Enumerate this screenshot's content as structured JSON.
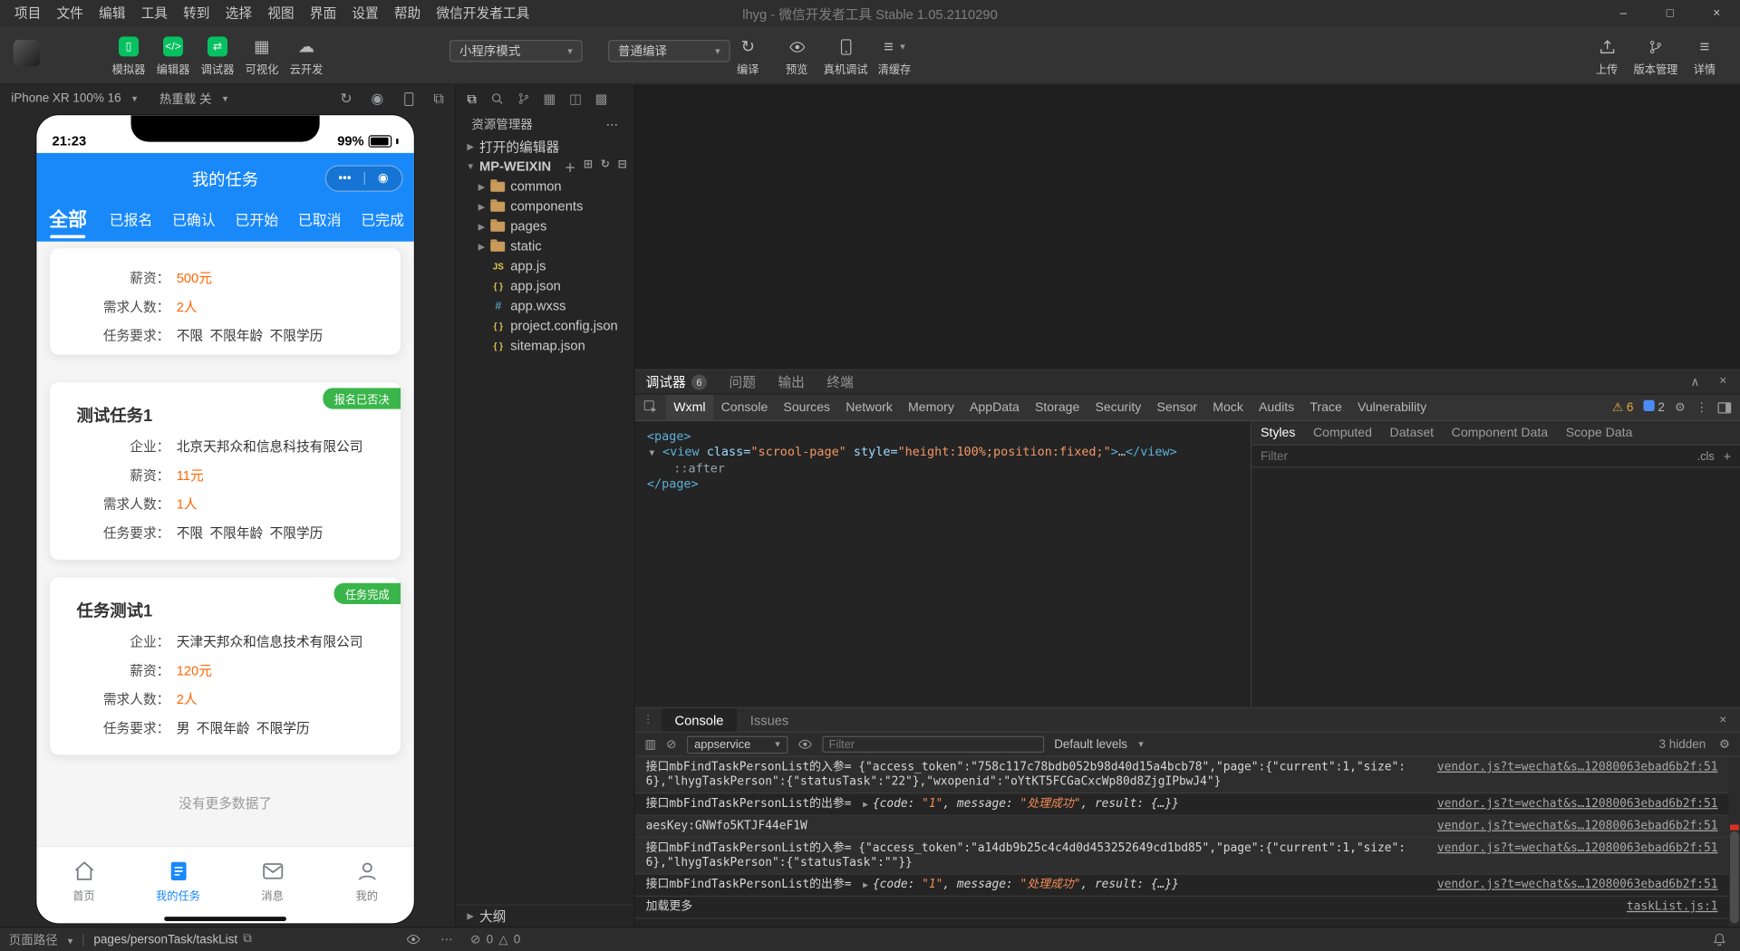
{
  "titlebar": {
    "menus": [
      "项目",
      "文件",
      "编辑",
      "工具",
      "转到",
      "选择",
      "视图",
      "界面",
      "设置",
      "帮助",
      "微信开发者工具"
    ],
    "title": "lhyg - 微信开发者工具 Stable 1.05.2110290"
  },
  "toolbar": {
    "simulator": "模拟器",
    "editor": "编辑器",
    "debugger": "调试器",
    "visualize": "可视化",
    "cloud": "云开发",
    "mode_select": "小程序模式",
    "compile_select": "普通编译",
    "compile": "编译",
    "preview": "预览",
    "real_device": "真机调试",
    "clear_cache": "清缓存",
    "upload": "上传",
    "version": "版本管理",
    "detail": "详情"
  },
  "simulator": {
    "device": "iPhone XR 100% 16",
    "hot_reload": "热重载 关",
    "phone": {
      "time": "21:23",
      "battery": "99%",
      "nav_title": "我的任务",
      "tabs": [
        "全部",
        "已报名",
        "已确认",
        "已开始",
        "已取消",
        "已完成"
      ],
      "cards": [
        {
          "salary_label": "薪资：",
          "salary": "500元",
          "count_label": "需求人数：",
          "count": "2人",
          "req_label": "任务要求：",
          "req": "不限",
          "age": "不限年龄",
          "edu": "不限学历"
        },
        {
          "badge": "报名已否决",
          "title": "测试任务1",
          "company_label": "企业：",
          "company": "北京天邦众和信息科技有限公司",
          "salary_label": "薪资：",
          "salary": "11元",
          "count_label": "需求人数：",
          "count": "1人",
          "req_label": "任务要求：",
          "req": "不限",
          "age": "不限年龄",
          "edu": "不限学历"
        },
        {
          "badge": "任务完成",
          "title": "任务测试1",
          "company_label": "企业：",
          "company": "天津天邦众和信息技术有限公司",
          "salary_label": "薪资：",
          "salary": "120元",
          "count_label": "需求人数：",
          "count": "2人",
          "req_label": "任务要求：",
          "req": "男",
          "age": "不限年龄",
          "edu": "不限学历"
        }
      ],
      "no_more": "没有更多数据了",
      "tabbar": [
        {
          "label": "首页"
        },
        {
          "label": "我的任务"
        },
        {
          "label": "消息"
        },
        {
          "label": "我的"
        }
      ]
    }
  },
  "explorer": {
    "panel_title": "资源管理器",
    "open_editors": "打开的编辑器",
    "project_name": "MP-WEIXIN",
    "folders": [
      "common",
      "components",
      "pages",
      "static"
    ],
    "files": [
      "app.js",
      "app.json",
      "app.wxss",
      "project.config.json",
      "sitemap.json"
    ],
    "outline": "大纲"
  },
  "debugger_panel": {
    "tab_debugger": "调试器",
    "badge": "6",
    "tab_problems": "问题",
    "tab_output": "输出",
    "tab_terminal": "终端",
    "devtools_tabs": [
      "Wxml",
      "Console",
      "Sources",
      "Network",
      "Memory",
      "AppData",
      "Storage",
      "Security",
      "Sensor",
      "Mock",
      "Audits",
      "Trace",
      "Vulnerability"
    ],
    "warn_count": "6",
    "info_count": "2",
    "wxml": {
      "page_open": "<page>",
      "view_open": "<view",
      "attr_class": "class=",
      "attr_class_val": "\"scrool-page\"",
      "attr_style": "style=",
      "attr_style_val": "\"height:100%;position:fixed;\"",
      "gt": ">",
      "ellipsis": "…",
      "view_close": "</view>",
      "pseudo": "::after",
      "page_close": "</page>"
    },
    "styles_pane": {
      "tabs": [
        "Styles",
        "Computed",
        "Dataset",
        "Component Data",
        "Scope Data"
      ],
      "filter_placeholder": "Filter",
      "cls": ".cls",
      "plus": "+"
    }
  },
  "console": {
    "tab_console": "Console",
    "tab_issues": "Issues",
    "context": "appservice",
    "filter_placeholder": "Filter",
    "levels": "Default levels",
    "hidden": "3 hidden",
    "preview": {
      "p1": "{code: ",
      "v1": "\"1\"",
      "p2": ", message: ",
      "v2": "\"处理成功\"",
      "p3": ", result: ",
      "p4": "{…}}"
    },
    "logs": [
      {
        "text": "接口mbFindTaskPersonList的入参= {\"access_token\":\"758c117c78bdb052b98d40d15a4bcb78\",\"page\":{\"current\":1,\"size\":6},\"lhygTaskPerson\":{\"statusTask\":\"22\"},\"wxopenid\":\"oYtKT5FCGaCxcWp80d8ZjgIPbwJ4\"}",
        "src": "vendor.js?t=wechat&s…12080063ebad6b2f:51"
      },
      {
        "prefix": "接口mbFindTaskPersonList的出参= ",
        "src": "vendor.js?t=wechat&s…12080063ebad6b2f:51"
      },
      {
        "text": "aesKey:GNWfo5KTJF44eF1W",
        "src": "vendor.js?t=wechat&s…12080063ebad6b2f:51"
      },
      {
        "text": "接口mbFindTaskPersonList的入参= {\"access_token\":\"a14db9b25c4c4d0d453252649cd1bd85\",\"page\":{\"current\":1,\"size\":6},\"lhygTaskPerson\":{\"statusTask\":\"\"}}",
        "src": "vendor.js?t=wechat&s…12080063ebad6b2f:51"
      },
      {
        "prefix": "接口mbFindTaskPersonList的出参= ",
        "src": "vendor.js?t=wechat&s…12080063ebad6b2f:51"
      },
      {
        "text": "加载更多",
        "src": "taskList.js:1"
      }
    ]
  },
  "statusbar": {
    "page_path_label": "页面路径",
    "page_path": "pages/personTask/taskList",
    "errors": "0",
    "warnings": "0"
  }
}
